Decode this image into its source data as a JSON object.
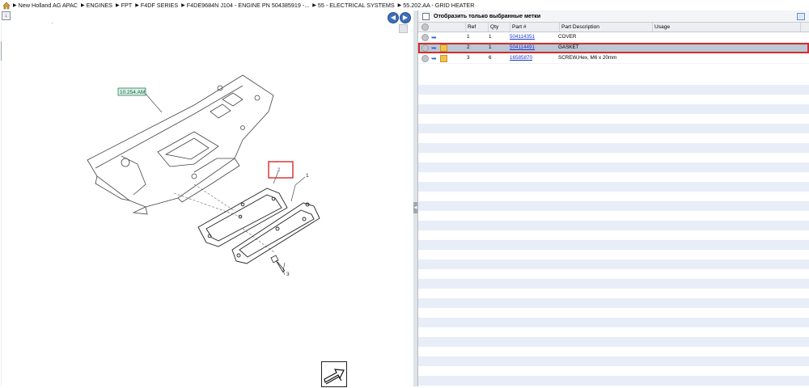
{
  "breadcrumb": {
    "items": [
      "New Holland AG APAC",
      "ENGINES",
      "FPT",
      "F4DF SERIES",
      "F4DE9684N J104 - ENGINE PN 504385919 -...",
      "55 - ELECTRICAL SYSTEMS",
      "55.202.AA - GRID HEATER"
    ]
  },
  "diagram": {
    "callout_ref": "10.254.AM",
    "label_1": "1",
    "label_2": "2",
    "label_3": "3"
  },
  "filter": {
    "label": "Отобразить только выбранные метки"
  },
  "table": {
    "headers": [
      "Ref",
      "Qty",
      "Part #",
      "Part Description",
      "Usage"
    ],
    "rows": [
      {
        "ref": "1",
        "qty": "1",
        "part": "504114351",
        "desc": "COVER",
        "usage": ""
      },
      {
        "ref": "2",
        "qty": "1",
        "part": "504114491",
        "desc": "GASKET",
        "usage": ""
      },
      {
        "ref": "3",
        "qty": "6",
        "part": "16585870",
        "desc": "SCREW,Hex, M6 x 20mm",
        "usage": ""
      }
    ],
    "selected_ref": "2"
  },
  "colors": {
    "selection": "#bcc8d6",
    "highlight_border": "#d42c2c",
    "link": "#1a3ad6",
    "stripe": "#e7eef8"
  }
}
